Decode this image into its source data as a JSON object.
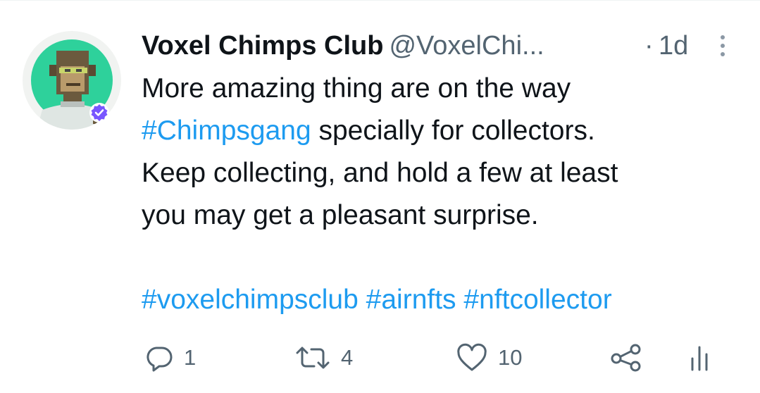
{
  "tweet": {
    "display_name": "Voxel Chimps Club",
    "handle": "@VoxelChi...",
    "separator": "·",
    "time": "1d",
    "more_icon": "more-vertical-icon",
    "avatar_icon": "chimp-avatar",
    "verified_icon": "verified-badge-icon",
    "text": {
      "line1": "More amazing thing are on the way",
      "hashtag1": "#Chimpsgang",
      "line2_rest": " specially for collectors.",
      "line3": "Keep collecting, and hold a few at least",
      "line4": "you may get a pleasant surprise.",
      "hashtags": [
        "#voxelchimpsclub",
        "#airnfts",
        "#nftcollector"
      ]
    }
  },
  "actions": {
    "reply": {
      "icon": "reply-icon",
      "count": "1"
    },
    "retweet": {
      "icon": "retweet-icon",
      "count": "4"
    },
    "like": {
      "icon": "heart-icon",
      "count": "10"
    },
    "share": {
      "icon": "share-icon"
    },
    "analytics": {
      "icon": "analytics-icon"
    }
  },
  "colors": {
    "text": "#0f1419",
    "secondary": "#536471",
    "link": "#1d9bf0",
    "avatar_bg": "#2ed19b",
    "verified": "#7856ff"
  }
}
